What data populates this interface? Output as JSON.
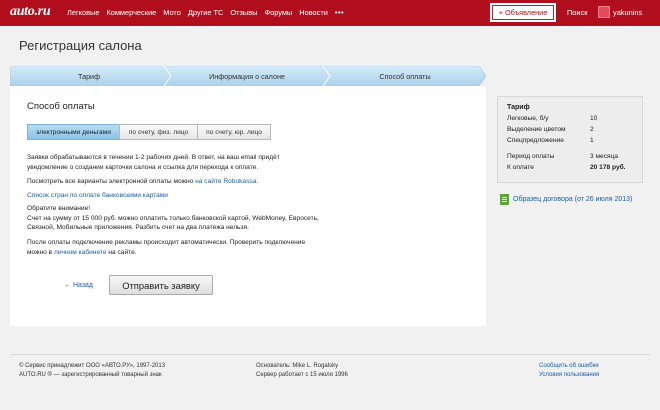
{
  "header": {
    "logo": "auto.ru",
    "nav": [
      "Легковые",
      "Коммерческие",
      "Мото",
      "Другие ТС",
      "Отзывы",
      "Форумы",
      "Новости"
    ],
    "more": "•••",
    "add_button": "+ Объявление",
    "search": "Поиск",
    "username": "yakunins"
  },
  "page_title": "Регистрация салона",
  "steps": [
    "Тариф",
    "Информация о салоне",
    "Способ оплаты"
  ],
  "payment": {
    "title": "Способ оплаты",
    "tabs": [
      "электронными деньгами",
      "по счету, физ. лицо",
      "по счету, юр. лицо"
    ],
    "p1_line1": "Заявки обрабатываются в течении 1-2 рабочих дней. В ответ, на ваш email придёт",
    "p1_line2": "уведомление о создании карточки салона и ссылка для перехода к оплате.",
    "p2_prefix": "Посмотреть все варианты электронной оплаты можно ",
    "p2_link": "на сайте Robokassa",
    "p2_suffix": ".",
    "banks_link": "Список стран по оплате банковскими картами",
    "attention": "Обратите внимание!",
    "p3_line1": "Счет на сумму от 15 000 руб. можно оплатить только банковской картой, WebMoney, Евросеть,",
    "p3_line2": "Связной, Мобильные приложения. Разбить счет на два платежа нельзя.",
    "p4_line1": "После оплаты подключение рекламы происходит автоматически. Проверить подключение",
    "p4_prefix": "можно в ",
    "p4_link": "личном кабинете",
    "p4_suffix": " на сайте.",
    "back": "← Назад",
    "submit": "Отправить заявку"
  },
  "tariff": {
    "title": "Тариф",
    "rows": [
      {
        "label": "Легковые, б/у",
        "value": "10"
      },
      {
        "label": "Выделение цветом",
        "value": "2"
      },
      {
        "label": "Спецпредложение",
        "value": "1"
      },
      {
        "label": "Период оплаты",
        "value": "3 месяца"
      },
      {
        "label": "К оплате",
        "value": "20 178 руб."
      }
    ]
  },
  "contract_link": "Образец договора (от 26 июля 2013)",
  "footer": {
    "left1": "© Сервис принадлежит ООО «АВТО.РУ», 1997-2013",
    "left2": "AUTO.RU ® — зарегистрированный товарный знак",
    "mid1": "Основатель: Mike L. Rogalsky",
    "mid2": "Сервер работает с 15 июля 1996",
    "right1": "Сообщить об ошибке",
    "right2": "Условия пользования"
  },
  "colors": {
    "brand": "#b10e1d",
    "link": "#1b5ca8",
    "active_tab": "#8cc3e6"
  }
}
